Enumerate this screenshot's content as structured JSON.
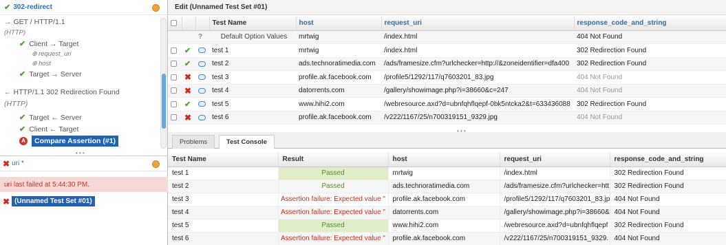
{
  "tree": {
    "header": "302-redirect",
    "request_line": "GET / HTTP/1.1",
    "request_protocol": "(HTTP)",
    "client_target": "Client → Target",
    "request_uri": "request_uri",
    "host": "host",
    "target_server": "Target → Server",
    "response_line": "HTTP/1.1 302 Redirection Found",
    "response_protocol": "(HTTP)",
    "target_server_back": "Target ← Server",
    "client_target_back": "Client ← Target",
    "compare_assertion": "Compare Assertion (#1)"
  },
  "lower_left": {
    "header": "uri *",
    "failed_msg": "uri last failed at 5:44:30 PM.",
    "test_set": "(Unnamed Test Set #01)"
  },
  "editor": {
    "title": "Edit (Unnamed Test Set #01)",
    "columns": [
      "Test Name",
      "host",
      "request_uri",
      "response_code_and_string"
    ],
    "default_row": {
      "name": "Default Option Values",
      "host": "mrtwig",
      "uri": "/index.html",
      "response": "404 Not Found"
    },
    "rows": [
      {
        "name": "test 1",
        "status": "ok",
        "kind": "bubble-alt",
        "host": "mrtwig",
        "uri": "/index.html",
        "response": "302 Redirection Found",
        "dim": false
      },
      {
        "name": "test 2",
        "status": "ok",
        "kind": "bubble",
        "host": "ads.technoratimedia.com",
        "uri": "/ads/framesize.cfm?urlchecker=http://&zoneidentifier=dfa400",
        "response": "302 Redirection Found",
        "dim": false
      },
      {
        "name": "test 3",
        "status": "x",
        "kind": "bubble",
        "host": "profile.ak.facebook.com",
        "uri": "/profile5/1292/117/q7603201_83.jpg",
        "response": "404 Not Found",
        "dim": true
      },
      {
        "name": "test 4",
        "status": "x",
        "kind": "bubble",
        "host": "datorrents.com",
        "uri": "/gallery/showimage.php?i=38660&c=247",
        "response": "404 Not Found",
        "dim": true
      },
      {
        "name": "test 5",
        "status": "ok",
        "kind": "bubble",
        "host": "www.hihi2.com",
        "uri": "/webresource.axd?d=ubnfqhflqepf-0bk5ntcka2&t=633436088",
        "response": "302 Redirection Found",
        "dim": false
      },
      {
        "name": "test 6",
        "status": "x",
        "kind": "bubble",
        "host": "profile.ak.facebook.com",
        "uri": "/v222/1167/25/n700319151_9329.jpg",
        "response": "404 Not Found",
        "dim": true
      }
    ]
  },
  "tabs": {
    "problems": "Problems",
    "console": "Test Console"
  },
  "console": {
    "columns": [
      "Test Name",
      "Result",
      "host",
      "request_uri",
      "response_code_and_string"
    ],
    "rows": [
      {
        "name": "test 1",
        "result": "Passed",
        "pass": true,
        "host": "mrtwig",
        "uri": "/index.html",
        "response": "302 Redirection Found"
      },
      {
        "name": "test 2",
        "result": "Passed",
        "pass": true,
        "host": "ads.technoratimedia.com",
        "uri": "/ads/framesize.cfm?urlchecker=htt",
        "response": "302 Redirection Found"
      },
      {
        "name": "test 3",
        "result": "Assertion failure: Expected value \"",
        "pass": false,
        "host": "profile.ak.facebook.com",
        "uri": "/profile5/1292/117/q7603201_83.jp",
        "response": "404 Not Found"
      },
      {
        "name": "test 4",
        "result": "Assertion failure: Expected value \"",
        "pass": false,
        "host": "datorrents.com",
        "uri": "/gallery/showimage.php?i=38660&",
        "response": "404 Not Found"
      },
      {
        "name": "test 5",
        "result": "Passed",
        "pass": true,
        "host": "www.hihi2.com",
        "uri": "/webresource.axd?d=ubnfqhflqepf",
        "response": "302 Redirection Found"
      },
      {
        "name": "test 6",
        "result": "Assertion failure: Expected value \"",
        "pass": false,
        "host": "profile.ak.facebook.com",
        "uri": "/v222/1167/25/n700319151_9329.",
        "response": "404 Not Found"
      }
    ]
  },
  "colors": {
    "accent": "#1e63b8",
    "pass_bg": "#dfeec8",
    "fail_text": "#d12b1e",
    "ok_green": "#4aa52e"
  }
}
